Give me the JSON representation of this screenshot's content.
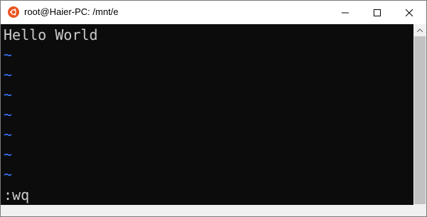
{
  "window": {
    "title": "root@Haier-PC: /mnt/e",
    "icon": "ubuntu-icon",
    "accent": "#e95420"
  },
  "controls": {
    "minimize_icon": "minimize-icon",
    "maximize_icon": "maximize-icon",
    "close_icon": "close-icon"
  },
  "terminal": {
    "background": "#0c0c0c",
    "text_color": "#cccccc",
    "tilde_color": "#3b78ff",
    "buffer_line": "Hello World",
    "empty_marker": "~",
    "empty_lines": [
      "~",
      "~",
      "~",
      "~",
      "~",
      "~",
      "~"
    ],
    "command_line": ":wq"
  }
}
